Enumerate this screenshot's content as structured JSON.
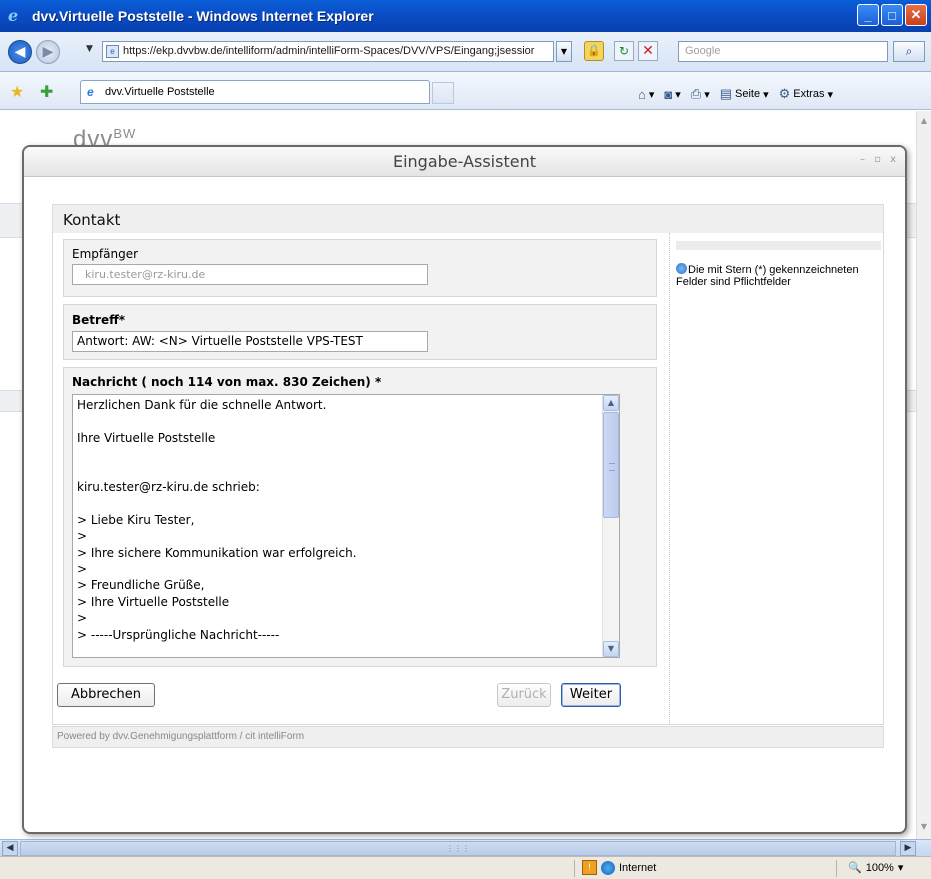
{
  "browser": {
    "window_title": "dvv.Virtuelle Poststelle - Windows Internet Explorer",
    "url": "https://ekp.dvvbw.de/intelliform/admin/intelliForm-Spaces/DVV/VPS/Eingang;jsessior",
    "search_placeholder": "Google",
    "tab_title": "dvv.Virtuelle Poststelle",
    "toolbar": {
      "page_label": "Seite",
      "extras_label": "Extras"
    },
    "status": {
      "zone": "Internet",
      "zoom": "100%"
    }
  },
  "page": {
    "logo_text": "dvv",
    "logo_sup": "BW"
  },
  "dialog": {
    "title": "Eingabe-Assistent",
    "controls": "– ▫ x",
    "form_title": "Kontakt",
    "recipient": {
      "label": "Empfänger",
      "value": "kiru.tester@rz-kiru.de"
    },
    "subject": {
      "label": "Betreff*",
      "value": "Antwort: AW: <N> Virtuelle Poststelle VPS-TEST"
    },
    "message": {
      "label": "Nachricht ( noch 114 von max. 830 Zeichen) *",
      "text": "Herzlichen Dank für die schnelle Antwort.\n\nIhre Virtuelle Poststelle\n\n\nkiru.tester@rz-kiru.de schrieb:\n\n> Liebe Kiru Tester,\n>\n> Ihre sichere Kommunikation war erfolgreich.\n>\n> Freundliche Grüße,\n> Ihre Virtuelle Poststelle\n>\n> -----Ursprüngliche Nachricht-----"
    },
    "buttons": {
      "cancel": "Abbrechen",
      "back": "Zurück",
      "next": "Weiter"
    },
    "hint": "Die mit Stern (*) gekennzeichneten Felder sind Pflichtfelder",
    "footer": "Powered by dvv.Genehmigungsplattform / cit intelliForm"
  }
}
